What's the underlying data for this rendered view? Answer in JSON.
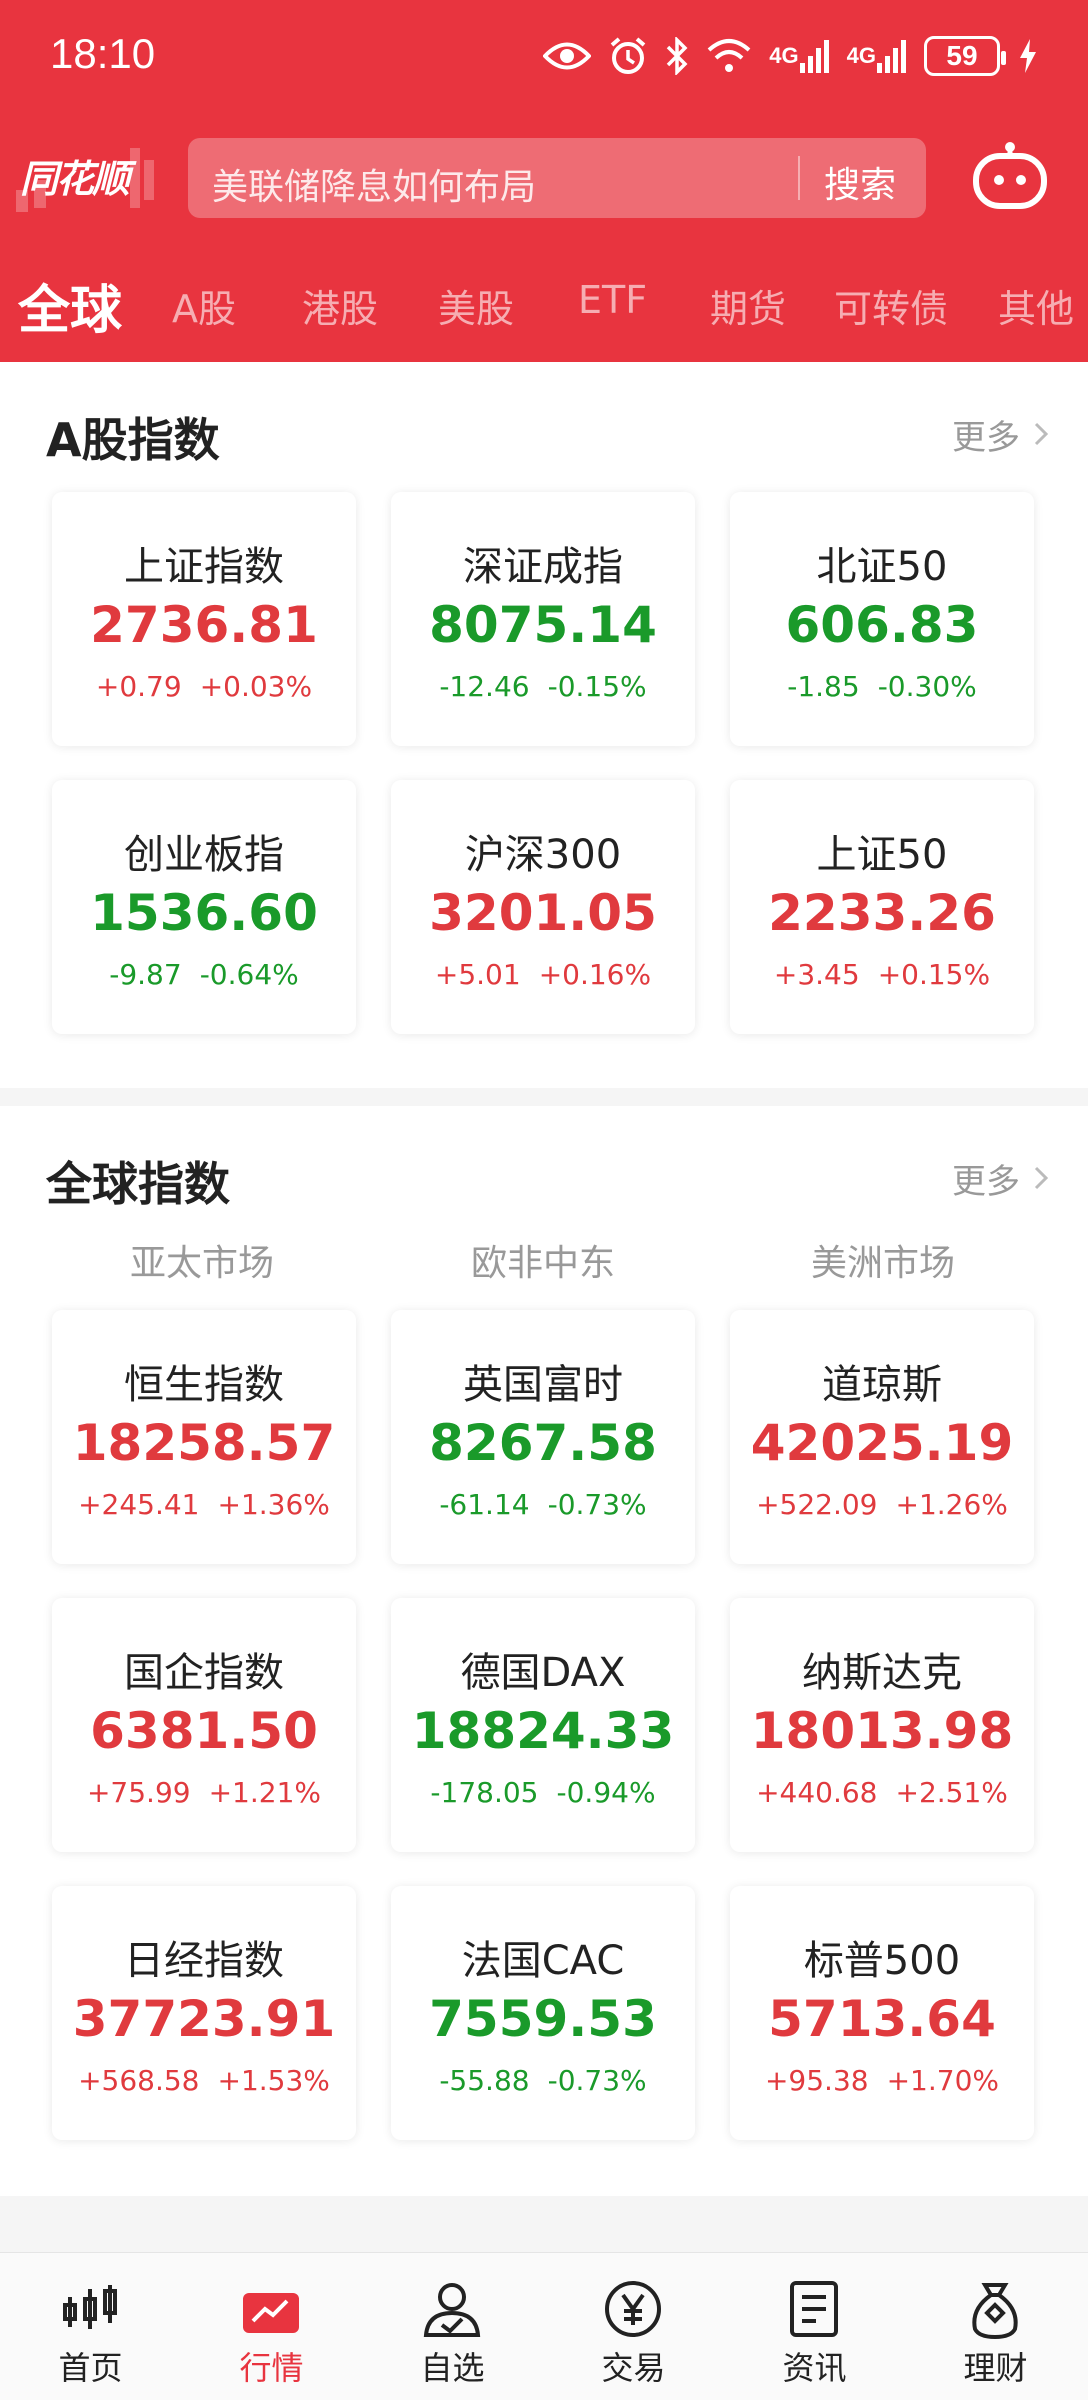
{
  "status_bar": {
    "time": "18:10",
    "network_1": "4G",
    "network_2": "4G",
    "battery": "59",
    "icons": [
      "eye-icon",
      "alarm-icon",
      "bluetooth-icon",
      "wifi-icon",
      "signal-icon",
      "signal-icon",
      "battery-icon",
      "charging-icon"
    ]
  },
  "header": {
    "logo": "同花顺",
    "search_placeholder": "美联储降息如何布局",
    "search_button": "搜索",
    "accent_color": "#e8343f"
  },
  "tabs": [
    "全球",
    "A股",
    "港股",
    "美股",
    "ETF",
    "期货",
    "可转债",
    "其他"
  ],
  "a_share": {
    "title": "A股指数",
    "more": "更多",
    "cards": [
      {
        "name": "上证指数",
        "value": "2736.81",
        "change": "+0.79",
        "pct": "+0.03%",
        "dir": "up"
      },
      {
        "name": "深证成指",
        "value": "8075.14",
        "change": "-12.46",
        "pct": "-0.15%",
        "dir": "down"
      },
      {
        "name": "北证50",
        "value": "606.83",
        "change": "-1.85",
        "pct": "-0.30%",
        "dir": "down"
      },
      {
        "name": "创业板指",
        "value": "1536.60",
        "change": "-9.87",
        "pct": "-0.64%",
        "dir": "down"
      },
      {
        "name": "沪深300",
        "value": "3201.05",
        "change": "+5.01",
        "pct": "+0.16%",
        "dir": "up"
      },
      {
        "name": "上证50",
        "value": "2233.26",
        "change": "+3.45",
        "pct": "+0.15%",
        "dir": "up"
      }
    ]
  },
  "global": {
    "title": "全球指数",
    "more": "更多",
    "regions": [
      "亚太市场",
      "欧非中东",
      "美洲市场"
    ],
    "cards": [
      {
        "name": "恒生指数",
        "value": "18258.57",
        "change": "+245.41",
        "pct": "+1.36%",
        "dir": "up"
      },
      {
        "name": "英国富时",
        "value": "8267.58",
        "change": "-61.14",
        "pct": "-0.73%",
        "dir": "down"
      },
      {
        "name": "道琼斯",
        "value": "42025.19",
        "change": "+522.09",
        "pct": "+1.26%",
        "dir": "up"
      },
      {
        "name": "国企指数",
        "value": "6381.50",
        "change": "+75.99",
        "pct": "+1.21%",
        "dir": "up"
      },
      {
        "name": "德国DAX",
        "value": "18824.33",
        "change": "-178.05",
        "pct": "-0.94%",
        "dir": "down"
      },
      {
        "name": "纳斯达克",
        "value": "18013.98",
        "change": "+440.68",
        "pct": "+2.51%",
        "dir": "up"
      },
      {
        "name": "日经指数",
        "value": "37723.91",
        "change": "+568.58",
        "pct": "+1.53%",
        "dir": "up"
      },
      {
        "name": "法国CAC",
        "value": "7559.53",
        "change": "-55.88",
        "pct": "-0.73%",
        "dir": "down"
      },
      {
        "name": "标普500",
        "value": "5713.64",
        "change": "+95.38",
        "pct": "+1.70%",
        "dir": "up"
      }
    ]
  },
  "bottom_nav": [
    {
      "label": "首页",
      "icon": "candlestick-icon"
    },
    {
      "label": "行情",
      "icon": "chart-icon",
      "active": true
    },
    {
      "label": "自选",
      "icon": "user-check-icon"
    },
    {
      "label": "交易",
      "icon": "yen-icon"
    },
    {
      "label": "资讯",
      "icon": "news-icon"
    },
    {
      "label": "理财",
      "icon": "money-bag-icon"
    }
  ]
}
